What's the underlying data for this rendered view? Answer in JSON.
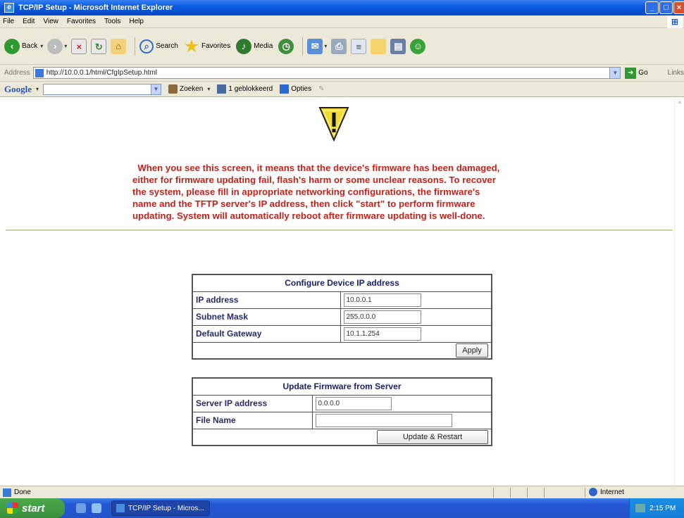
{
  "window": {
    "title": "TCP/IP Setup - Microsoft Internet Explorer"
  },
  "menu": [
    "File",
    "Edit",
    "View",
    "Favorites",
    "Tools",
    "Help"
  ],
  "toolbar": {
    "back_label": "Back",
    "search_label": "Search",
    "favorites_label": "Favorites",
    "media_label": "Media"
  },
  "address": {
    "label": "Address",
    "url": "http://10.0.0.1/html/CfgIpSetup.html",
    "go_label": "Go",
    "links_label": "Links"
  },
  "google_bar": {
    "logo": "Google",
    "search_label": "Zoeken",
    "blocked_label": "1 geblokkeerd",
    "options_label": "Opties"
  },
  "page": {
    "warning_text": "  When you see this screen, it means that the device's firmware has been damaged,\neither for firmware updating fail, flash's harm or some unclear reasons. To recover\nthe system, please fill in appropriate networking configurations, the firmware's\nname and the TFTP server's IP address, then click \"start\" to perform firmware\nupdating. System will automatically reboot after firmware updating is well-done.",
    "ip_form": {
      "heading": "Configure Device IP address",
      "rows": [
        {
          "label": "IP address",
          "value": "10.0.0.1"
        },
        {
          "label": "Subnet Mask",
          "value": "255.0.0.0"
        },
        {
          "label": "Default Gateway",
          "value": "10.1.1.254"
        }
      ],
      "apply_label": "Apply"
    },
    "fw_form": {
      "heading": "Update Firmware from Server",
      "server_label": "Server IP address",
      "server_value": "0.0.0.0",
      "file_label": "File Name",
      "file_value": "",
      "update_label": "Update & Restart"
    }
  },
  "status": {
    "text": "Done",
    "zone": "Internet"
  },
  "taskbar": {
    "start_label": "start",
    "task_label": "TCP/IP Setup - Micros...",
    "clock": "2:15 PM"
  },
  "colors": {
    "warning_text": "#c9201a",
    "title_bar": "#0a5ce0",
    "start_button": "#3a8f3a"
  }
}
